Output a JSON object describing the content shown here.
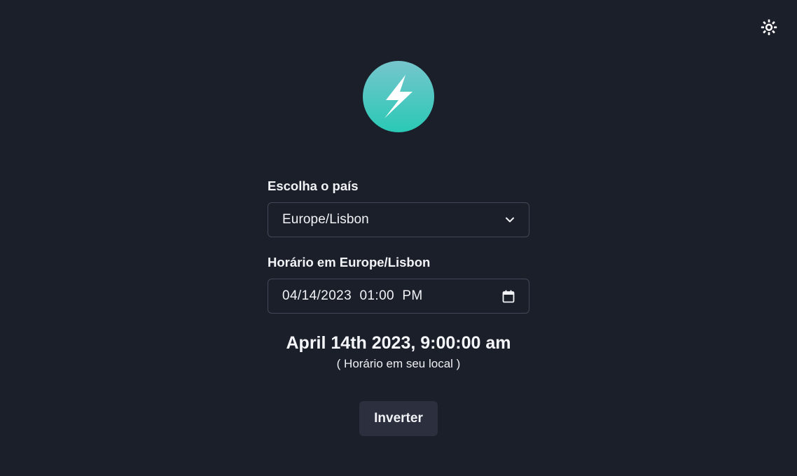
{
  "header": {
    "theme_toggle_icon": "sun-icon"
  },
  "logo": {
    "icon": "lightning-bolt-icon",
    "gradient_top": "#76c6cd",
    "gradient_bottom": "#2ac9b5"
  },
  "country": {
    "label": "Escolha o país",
    "selected": "Europe/Lisbon",
    "icon": "chevron-down-icon"
  },
  "datetime": {
    "label": "Horário em Europe/Lisbon",
    "value": "04/14/2023  01:00  PM",
    "icon": "calendar-icon"
  },
  "result": {
    "time": "April 14th 2023, 9:00:00 am",
    "note": "( Horário em seu local )"
  },
  "actions": {
    "invert_label": "Inverter"
  },
  "colors": {
    "background": "#1b1f2a",
    "button_bg": "#2c303e",
    "border": "#424857"
  }
}
